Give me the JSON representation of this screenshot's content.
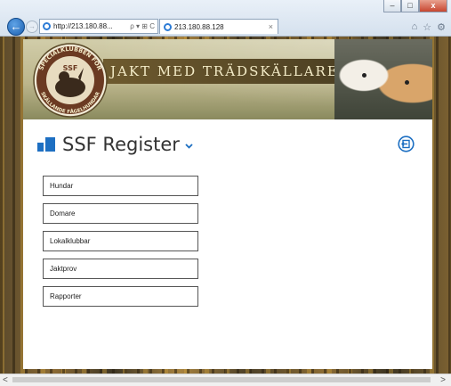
{
  "browser": {
    "address_url": "http://213.180.88...",
    "address_controls": "ρ ▾ ⊞ C",
    "tab_title": "213.180.88.128",
    "tab_close": "×",
    "window_controls": {
      "minimize": "–",
      "maximize": "□",
      "close": "x"
    },
    "back_glyph": "←",
    "forward_glyph": "→",
    "toolbar_icons": [
      "home-icon",
      "star-icon",
      "gear-icon"
    ],
    "toolbar_glyphs": {
      "home": "⌂",
      "favorites": "☆",
      "tools": "⚙"
    }
  },
  "banner": {
    "title": "JAKT MED TRÄDSKÄLLARE",
    "logo_text": {
      "top": "SPECIALKLUBBEN FÖR",
      "center": "SSF",
      "bottom": "SKÄLLANDE FÅGELHUNDAR"
    }
  },
  "app": {
    "title": "SSF Register",
    "accent_color": "#1d6fc2",
    "menu": [
      {
        "label": "Hundar"
      },
      {
        "label": "Domare"
      },
      {
        "label": "Lokalklubbar"
      },
      {
        "label": "Jaktprov"
      },
      {
        "label": "Rapporter"
      }
    ]
  },
  "scrollbar": {
    "left": "<",
    "right": ">"
  }
}
